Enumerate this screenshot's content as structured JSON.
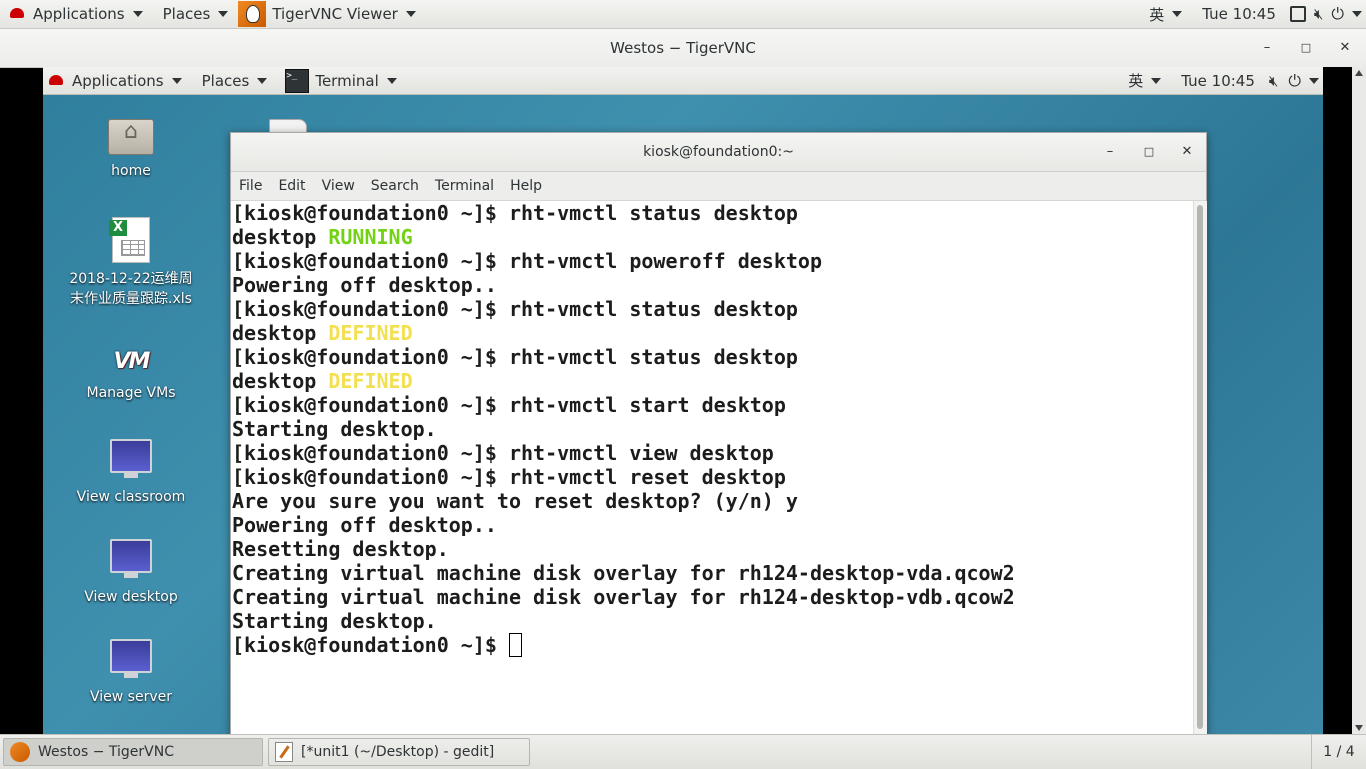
{
  "outer_topbar": {
    "applications": "Applications",
    "places": "Places",
    "window_title": "TigerVNC Viewer",
    "input_method": "英",
    "clock": "Tue 10:45"
  },
  "vnc_window": {
    "title": "Westos − TigerVNC",
    "minimize": "–",
    "maximize": "□",
    "close": "✕"
  },
  "remote_topbar": {
    "applications": "Applications",
    "places": "Places",
    "window_title": "Terminal",
    "input_method": "英",
    "clock": "Tue 10:45"
  },
  "desktop_icons": [
    {
      "label": "home",
      "icon": "folder-home-icon"
    },
    {
      "label": "2018-12-22运维周末作业质量跟踪.xls",
      "icon": "spreadsheet-icon"
    },
    {
      "label": "Manage VMs",
      "icon": "vm-manager-icon"
    },
    {
      "label": "View classroom",
      "icon": "monitor-icon"
    },
    {
      "label": "View desktop",
      "icon": "monitor-icon"
    },
    {
      "label": "View server",
      "icon": "monitor-icon"
    }
  ],
  "terminal": {
    "title": "kiosk@foundation0:~",
    "menu": [
      "File",
      "Edit",
      "View",
      "Search",
      "Terminal",
      "Help"
    ],
    "prompt": "[kiosk@foundation0 ~]$ ",
    "lines": [
      "[kiosk@foundation0 ~]$ rht-vmctl status desktop",
      "desktop ",
      "RUNNING",
      "[kiosk@foundation0 ~]$ rht-vmctl poweroff desktop",
      "Powering off desktop..",
      "[kiosk@foundation0 ~]$ rht-vmctl status desktop",
      "desktop ",
      "DEFINED",
      "[kiosk@foundation0 ~]$ rht-vmctl status desktop",
      "desktop ",
      "DEFINED",
      "[kiosk@foundation0 ~]$ rht-vmctl start desktop",
      "Starting desktop.",
      "[kiosk@foundation0 ~]$ rht-vmctl view desktop",
      "[kiosk@foundation0 ~]$ rht-vmctl reset desktop",
      "Are you sure you want to reset desktop? (y/n) y",
      "Powering off desktop..",
      "Resetting desktop.",
      "Creating virtual machine disk overlay for rh124-desktop-vda.qcow2",
      "Creating virtual machine disk overlay for rh124-desktop-vdb.qcow2",
      "Starting desktop."
    ],
    "colors": {
      "running": "#73d216",
      "defined": "#f3e050"
    }
  },
  "taskbar": {
    "items": [
      "Westos − TigerVNC",
      "[*unit1 (~/Desktop) - gedit]"
    ],
    "workspace": "1 / 4"
  }
}
